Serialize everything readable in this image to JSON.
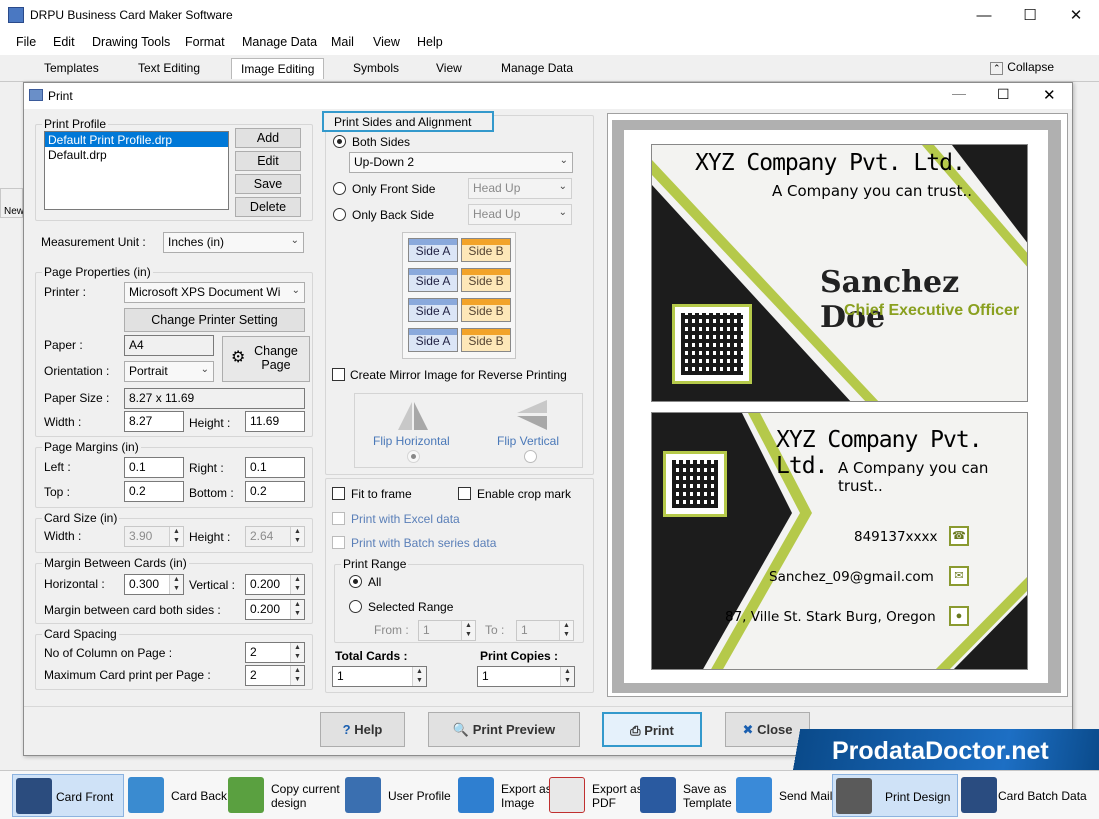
{
  "app": {
    "title": "DRPU Business Card Maker Software"
  },
  "menu": [
    "File",
    "Edit",
    "Drawing Tools",
    "Format",
    "Manage Data",
    "Mail",
    "View",
    "Help"
  ],
  "ribbon_tabs": [
    "Templates",
    "Text Editing",
    "Image Editing",
    "Symbols",
    "View",
    "Manage Data"
  ],
  "ribbon_active": "Image Editing",
  "collapse_label": "Collapse",
  "left_stub": "New",
  "dialog": {
    "title": "Print",
    "print_profile": {
      "legend": "Print Profile",
      "items": [
        "Default Print Profile.drp",
        "Default.drp"
      ],
      "buttons": [
        "Add",
        "Edit",
        "Save",
        "Delete"
      ]
    },
    "measurement_unit": {
      "label": "Measurement Unit :",
      "value": "Inches (in)"
    },
    "page_properties": {
      "legend": "Page Properties (in)",
      "printer_label": "Printer :",
      "printer_value": "Microsoft XPS Document Wi",
      "change_printer": "Change Printer Setting",
      "paper_label": "Paper :",
      "paper_value": "A4",
      "change_page": "Change Page",
      "orientation_label": "Orientation :",
      "orientation_value": "Portrait",
      "paper_size_label": "Paper Size :",
      "paper_size_value": "8.27 x 11.69",
      "width_label": "Width :",
      "width_value": "8.27",
      "height_label": "Height :",
      "height_value": "11.69"
    },
    "page_margins": {
      "legend": "Page Margins (in)",
      "left_label": "Left :",
      "left_value": "0.1",
      "right_label": "Right :",
      "right_value": "0.1",
      "top_label": "Top :",
      "top_value": "0.2",
      "bottom_label": "Bottom :",
      "bottom_value": "0.2"
    },
    "card_size": {
      "legend": "Card Size (in)",
      "width_label": "Width :",
      "width_value": "3.90",
      "height_label": "Height :",
      "height_value": "2.64"
    },
    "margin_between": {
      "legend": "Margin Between Cards (in)",
      "horizontal_label": "Horizontal :",
      "horizontal_value": "0.300",
      "vertical_label": "Vertical :",
      "vertical_value": "0.200",
      "both_label": "Margin between card both sides :",
      "both_value": "0.200"
    },
    "card_spacing": {
      "legend": "Card Spacing",
      "columns_label": "No of Column on Page :",
      "columns_value": "2",
      "max_label": "Maximum Card print per Page :",
      "max_value": "2"
    },
    "sides": {
      "legend": "Print Sides and Alignment",
      "both": "Both Sides",
      "both_mode": "Up-Down 2",
      "front": "Only Front Side",
      "front_mode": "Head Up",
      "back": "Only Back Side",
      "back_mode": "Head Up",
      "side_a": "Side A",
      "side_b": "Side B",
      "mirror": "Create Mirror Image for Reverse Printing",
      "flip_h": "Flip Horizontal",
      "flip_v": "Flip Vertical"
    },
    "options": {
      "fit": "Fit to frame",
      "crop": "Enable crop mark",
      "excel": "Print with Excel data",
      "batch": "Print with Batch series data"
    },
    "print_range": {
      "legend": "Print Range",
      "all": "All",
      "selected": "Selected Range",
      "from_label": "From :",
      "from_value": "1",
      "to_label": "To :",
      "to_value": "1"
    },
    "total_cards_label": "Total Cards :",
    "total_cards_value": "1",
    "print_copies_label": "Print Copies :",
    "print_copies_value": "1",
    "buttons": {
      "help": "Help",
      "preview": "Print Preview",
      "print": "Print",
      "close": "Close"
    }
  },
  "card_front": {
    "company": "XYZ Company Pvt. Ltd.",
    "tagline": "A Company you can trust..",
    "name": "Sanchez Doe",
    "role": "Chief Executive Officer"
  },
  "card_back": {
    "company": "XYZ Company Pvt. Ltd.",
    "tagline": "A Company you can trust..",
    "phone": "849137xxxx",
    "email": "Sanchez_09@gmail.com",
    "address": "87, Ville St. Stark Burg, Oregon"
  },
  "watermark": "ProdataDoctor.net",
  "taskbar": [
    {
      "label": "Card Front",
      "icon": "card-front-icon"
    },
    {
      "label": "Card Back",
      "icon": "card-back-icon"
    },
    {
      "label": "Copy current design",
      "icon": "copy-design-icon"
    },
    {
      "label": "User Profile",
      "icon": "user-profile-icon"
    },
    {
      "label": "Export as Image",
      "icon": "export-image-icon"
    },
    {
      "label": "Export as PDF",
      "icon": "export-pdf-icon"
    },
    {
      "label": "Save as Template",
      "icon": "save-template-icon"
    },
    {
      "label": "Send Mail",
      "icon": "send-mail-icon"
    },
    {
      "label": "Print Design",
      "icon": "printer-icon"
    },
    {
      "label": "Card Batch Data",
      "icon": "batch-data-icon"
    }
  ],
  "colors": {
    "accent_green": "#b5c94a",
    "dark": "#1a1a1a",
    "select_blue": "#0078d7"
  }
}
